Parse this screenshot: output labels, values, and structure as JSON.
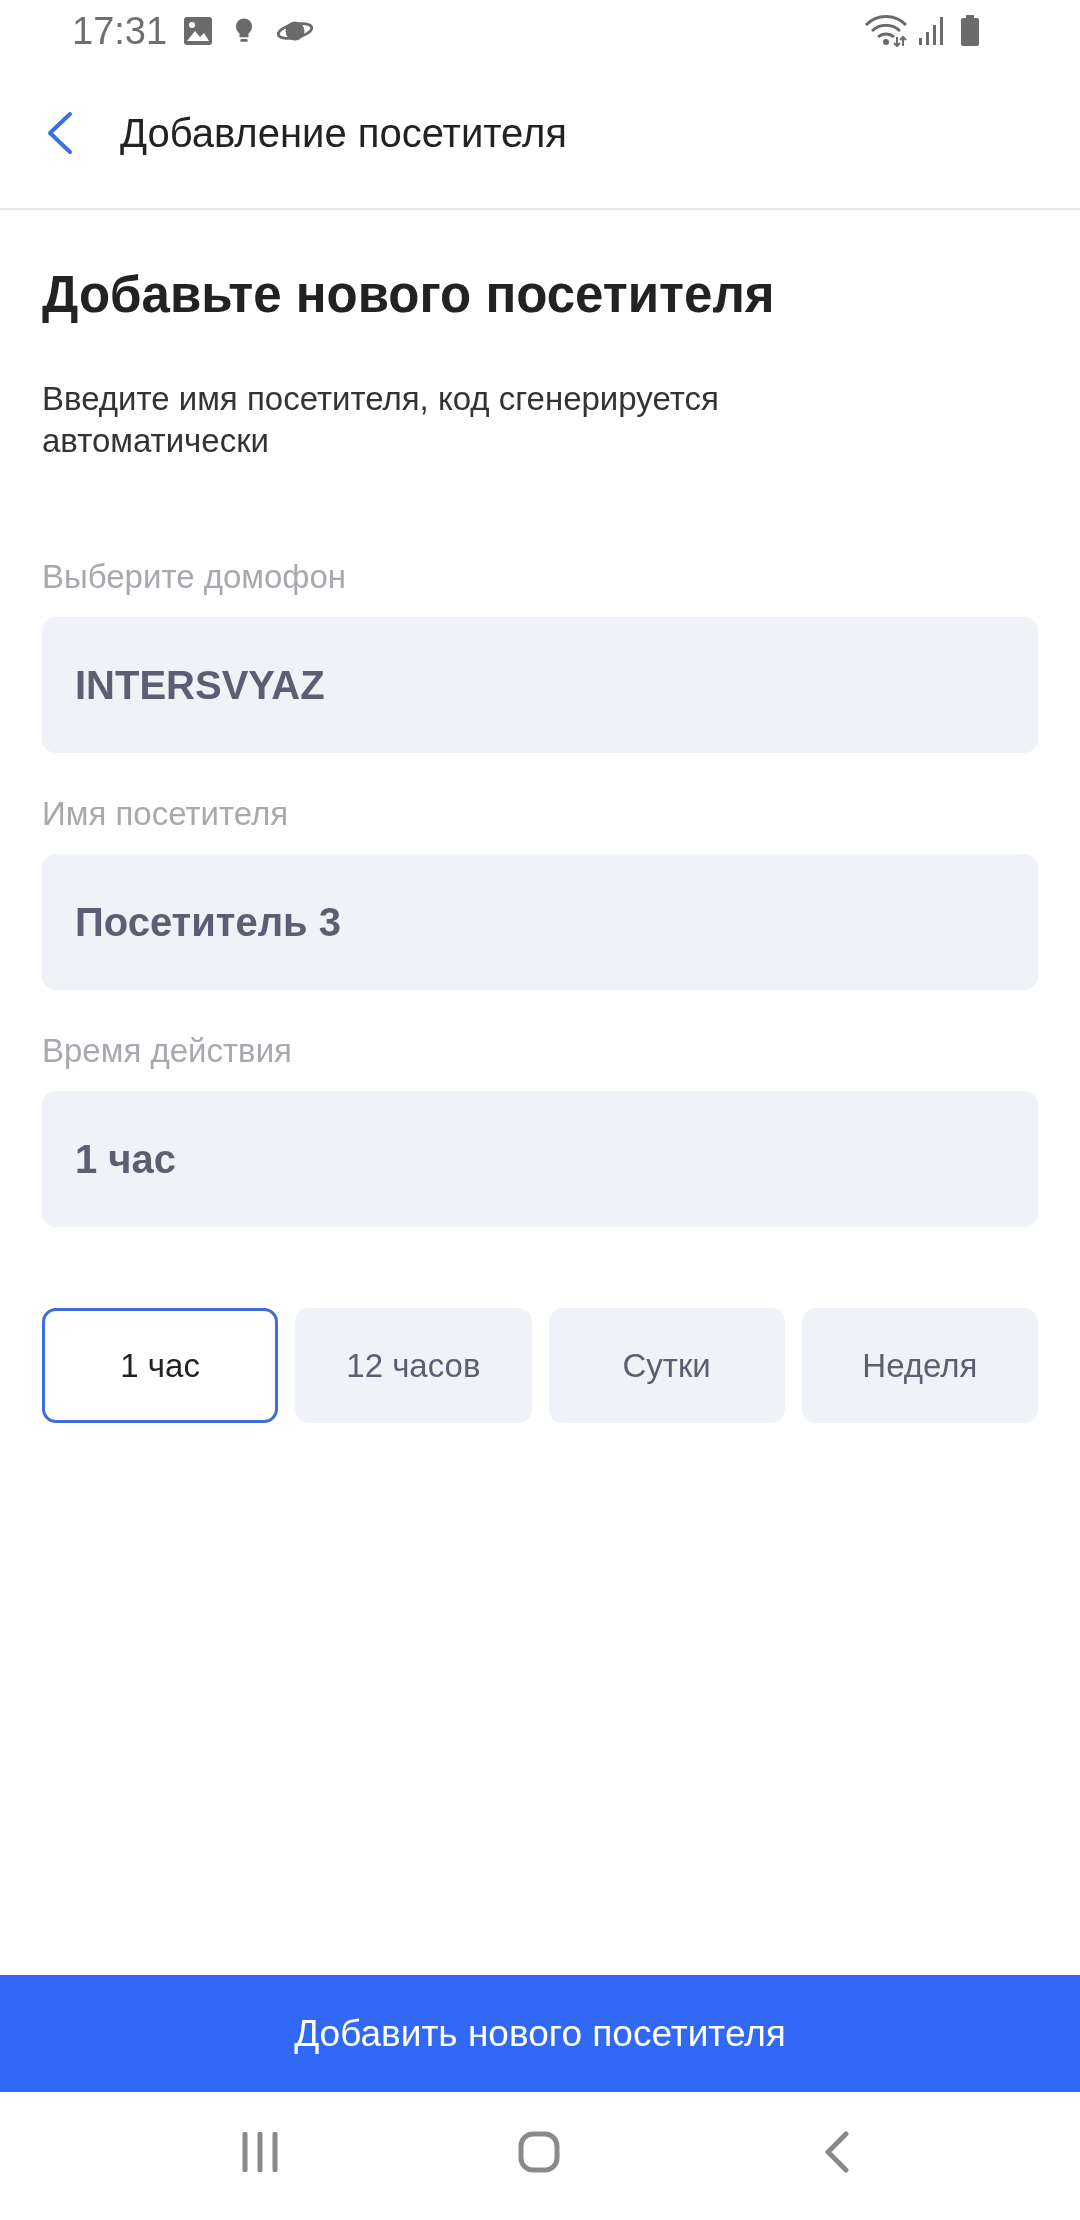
{
  "status_bar": {
    "time": "17:31"
  },
  "header": {
    "title": "Добавление посетителя"
  },
  "heading": "Добавьте нового посетителя",
  "description": "Введите имя посетителя, код сгенерируется автоматически",
  "fields": [
    {
      "label": "Выберите домофон",
      "value": "INTERSVYAZ"
    },
    {
      "label": "Имя посетителя",
      "value": "Посетитель 3"
    },
    {
      "label": "Время действия",
      "value": "1 час"
    }
  ],
  "duration_options": [
    {
      "label": "1 час",
      "selected": true
    },
    {
      "label": "12 часов",
      "selected": false
    },
    {
      "label": "Сутки",
      "selected": false
    },
    {
      "label": "Неделя",
      "selected": false
    }
  ],
  "submit_button": "Добавить нового посетителя"
}
